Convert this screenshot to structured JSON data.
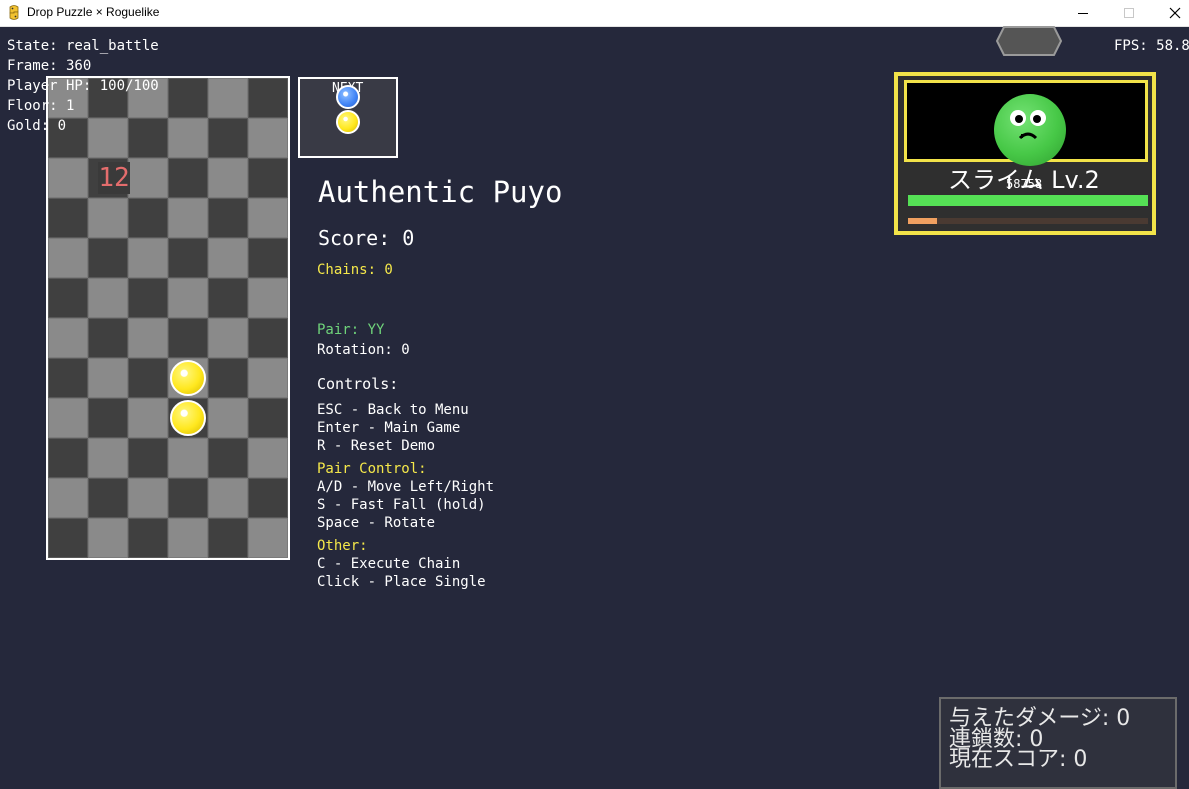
{
  "window": {
    "title": "Drop Puzzle × Roguelike"
  },
  "debug": {
    "state": "State: real_battle",
    "frame": "Frame: 360",
    "player_hp": "Player HP: 100/100",
    "floor": "Floor: 1",
    "gold": "Gold: 0",
    "fps": "FPS: 58.8"
  },
  "board": {
    "columns": 6,
    "rows": 12,
    "counter": "12",
    "puyos": [
      {
        "col": 3,
        "row": 7,
        "color": "yellow"
      },
      {
        "col": 3,
        "row": 8,
        "color": "yellow"
      }
    ]
  },
  "next": {
    "label": "NEXT",
    "pair": [
      "blue",
      "yellow"
    ]
  },
  "info": {
    "title": "Authentic Puyo",
    "score": "Score: 0",
    "chains": "Chains: 0",
    "pair": "Pair: YY",
    "rotation": "Rotation: 0",
    "controls_header": "Controls:",
    "controls": [
      "ESC - Back to Menu",
      "Enter - Main Game",
      "R - Reset Demo"
    ],
    "pair_control_header": "Pair Control:",
    "pair_controls": [
      "A/D - Move Left/Right",
      "S - Fast Fall (hold)",
      "Space - Rotate"
    ],
    "other_header": "Other:",
    "other_controls": [
      "C - Execute Chain",
      "Click - Place Single"
    ]
  },
  "enemy": {
    "name": "スライム Lv.2",
    "hp_text": "58758",
    "hp_fraction": 1.0,
    "attack_fraction": 0.12
  },
  "stats": {
    "damage": "与えたダメージ: 0",
    "chains": "連鎖数: 0",
    "score": "現在スコア: 0"
  },
  "colors": {
    "background": "#25283b",
    "puyo_yellow": "#ffe81f",
    "puyo_blue": "#3f82f5",
    "accent_yellow": "#f2e349",
    "accent_green": "#6fd37a",
    "counter_red": "#e46d6d"
  }
}
